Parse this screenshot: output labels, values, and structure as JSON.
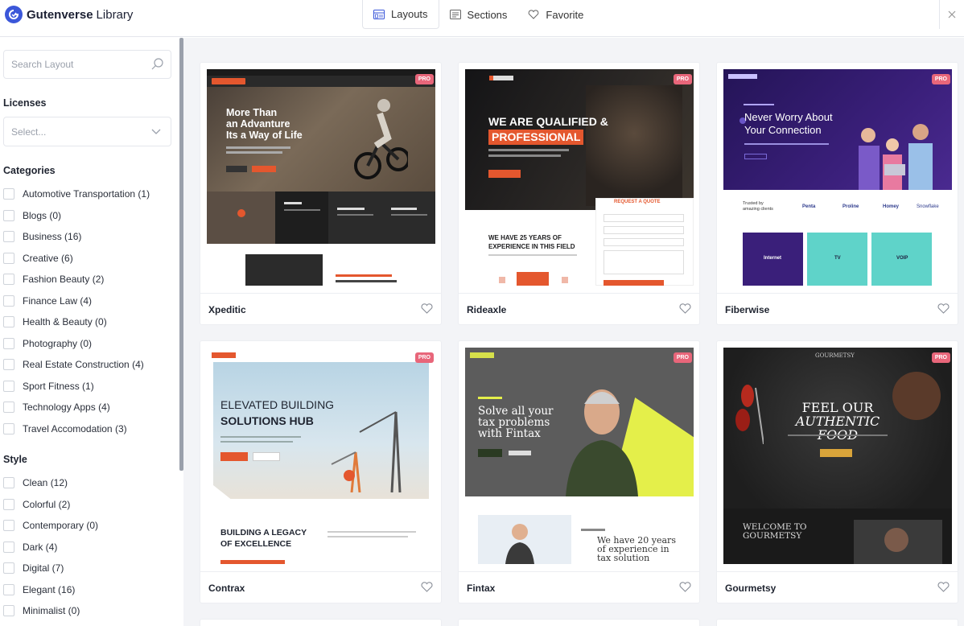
{
  "header": {
    "brand_bold": "Gutenverse",
    "brand_light": "Library",
    "tabs": [
      {
        "label": "Layouts",
        "icon": "layout-icon",
        "active": true
      },
      {
        "label": "Sections",
        "icon": "section-icon",
        "active": false
      },
      {
        "label": "Favorite",
        "icon": "heart-icon",
        "active": false
      }
    ],
    "close_icon": "close-icon"
  },
  "sidebar": {
    "search_placeholder": "Search Layout",
    "licenses_heading": "Licenses",
    "licenses_placeholder": "Select...",
    "categories_heading": "Categories",
    "categories": [
      "Automotive Transportation (1)",
      "Blogs (0)",
      "Business (16)",
      "Creative (6)",
      "Fashion Beauty (2)",
      "Finance Law (4)",
      "Health & Beauty (0)",
      "Photography (0)",
      "Real Estate Construction (4)",
      "Sport Fitness (1)",
      "Technology Apps (4)",
      "Travel Accomodation (3)"
    ],
    "style_heading": "Style",
    "styles": [
      "Clean (12)",
      "Colorful (2)",
      "Contemporary (0)",
      "Dark (4)",
      "Digital (7)",
      "Elegant (16)",
      "Minimalist (0)"
    ]
  },
  "layouts": [
    {
      "name": "Xpeditic",
      "badge": "PRO",
      "headline": [
        "More Than",
        "an Advanture",
        "Its a Way of Life"
      ],
      "theme": "#2b2b2b"
    },
    {
      "name": "Rideaxle",
      "badge": "PRO",
      "headline": [
        "WE ARE QUALIFIED &",
        "PROFESSIONAL"
      ],
      "sub": [
        "WE HAVE 25 YEARS OF",
        "EXPERIENCE IN THIS FIELD"
      ],
      "cta": "REQUEST A QUOTE",
      "theme": "#1d1d1f"
    },
    {
      "name": "Fiberwise",
      "badge": "PRO",
      "headline": [
        "Never Worry About",
        "Your Connection"
      ],
      "trusted": [
        "Trusted by",
        "amazing clients"
      ],
      "brands": [
        "Penta",
        "Proline",
        "Homey",
        "Snowflake"
      ],
      "services": [
        "Internet",
        "TV",
        "VOIP"
      ],
      "theme": "#2d1b6b"
    },
    {
      "name": "Contrax",
      "badge": "PRO",
      "headline": [
        "ELEVATED BUILDING",
        "SOLUTIONS HUB"
      ],
      "sub": [
        "BUILDING A LEGACY",
        "OF EXCELLENCE"
      ],
      "theme": "#f4f1ec"
    },
    {
      "name": "Fintax",
      "badge": "PRO",
      "headline": [
        "Solve all your",
        "tax problems",
        "with Fintax"
      ],
      "sub": [
        "We have 20 years",
        "of experience in",
        "tax solution"
      ],
      "theme": "#5a5a5a"
    },
    {
      "name": "Gourmetsy",
      "badge": "PRO",
      "headline": [
        "FEEL OUR",
        "AUTHENTIC FOOD"
      ],
      "sub": [
        "WELCOME TO",
        "GOURMETSY"
      ],
      "brand": "GOURMETSY",
      "theme": "#2a2a2a"
    }
  ],
  "colors": {
    "accent": "#3b57d9",
    "pro": "#e8667a",
    "orange": "#e4572e"
  }
}
